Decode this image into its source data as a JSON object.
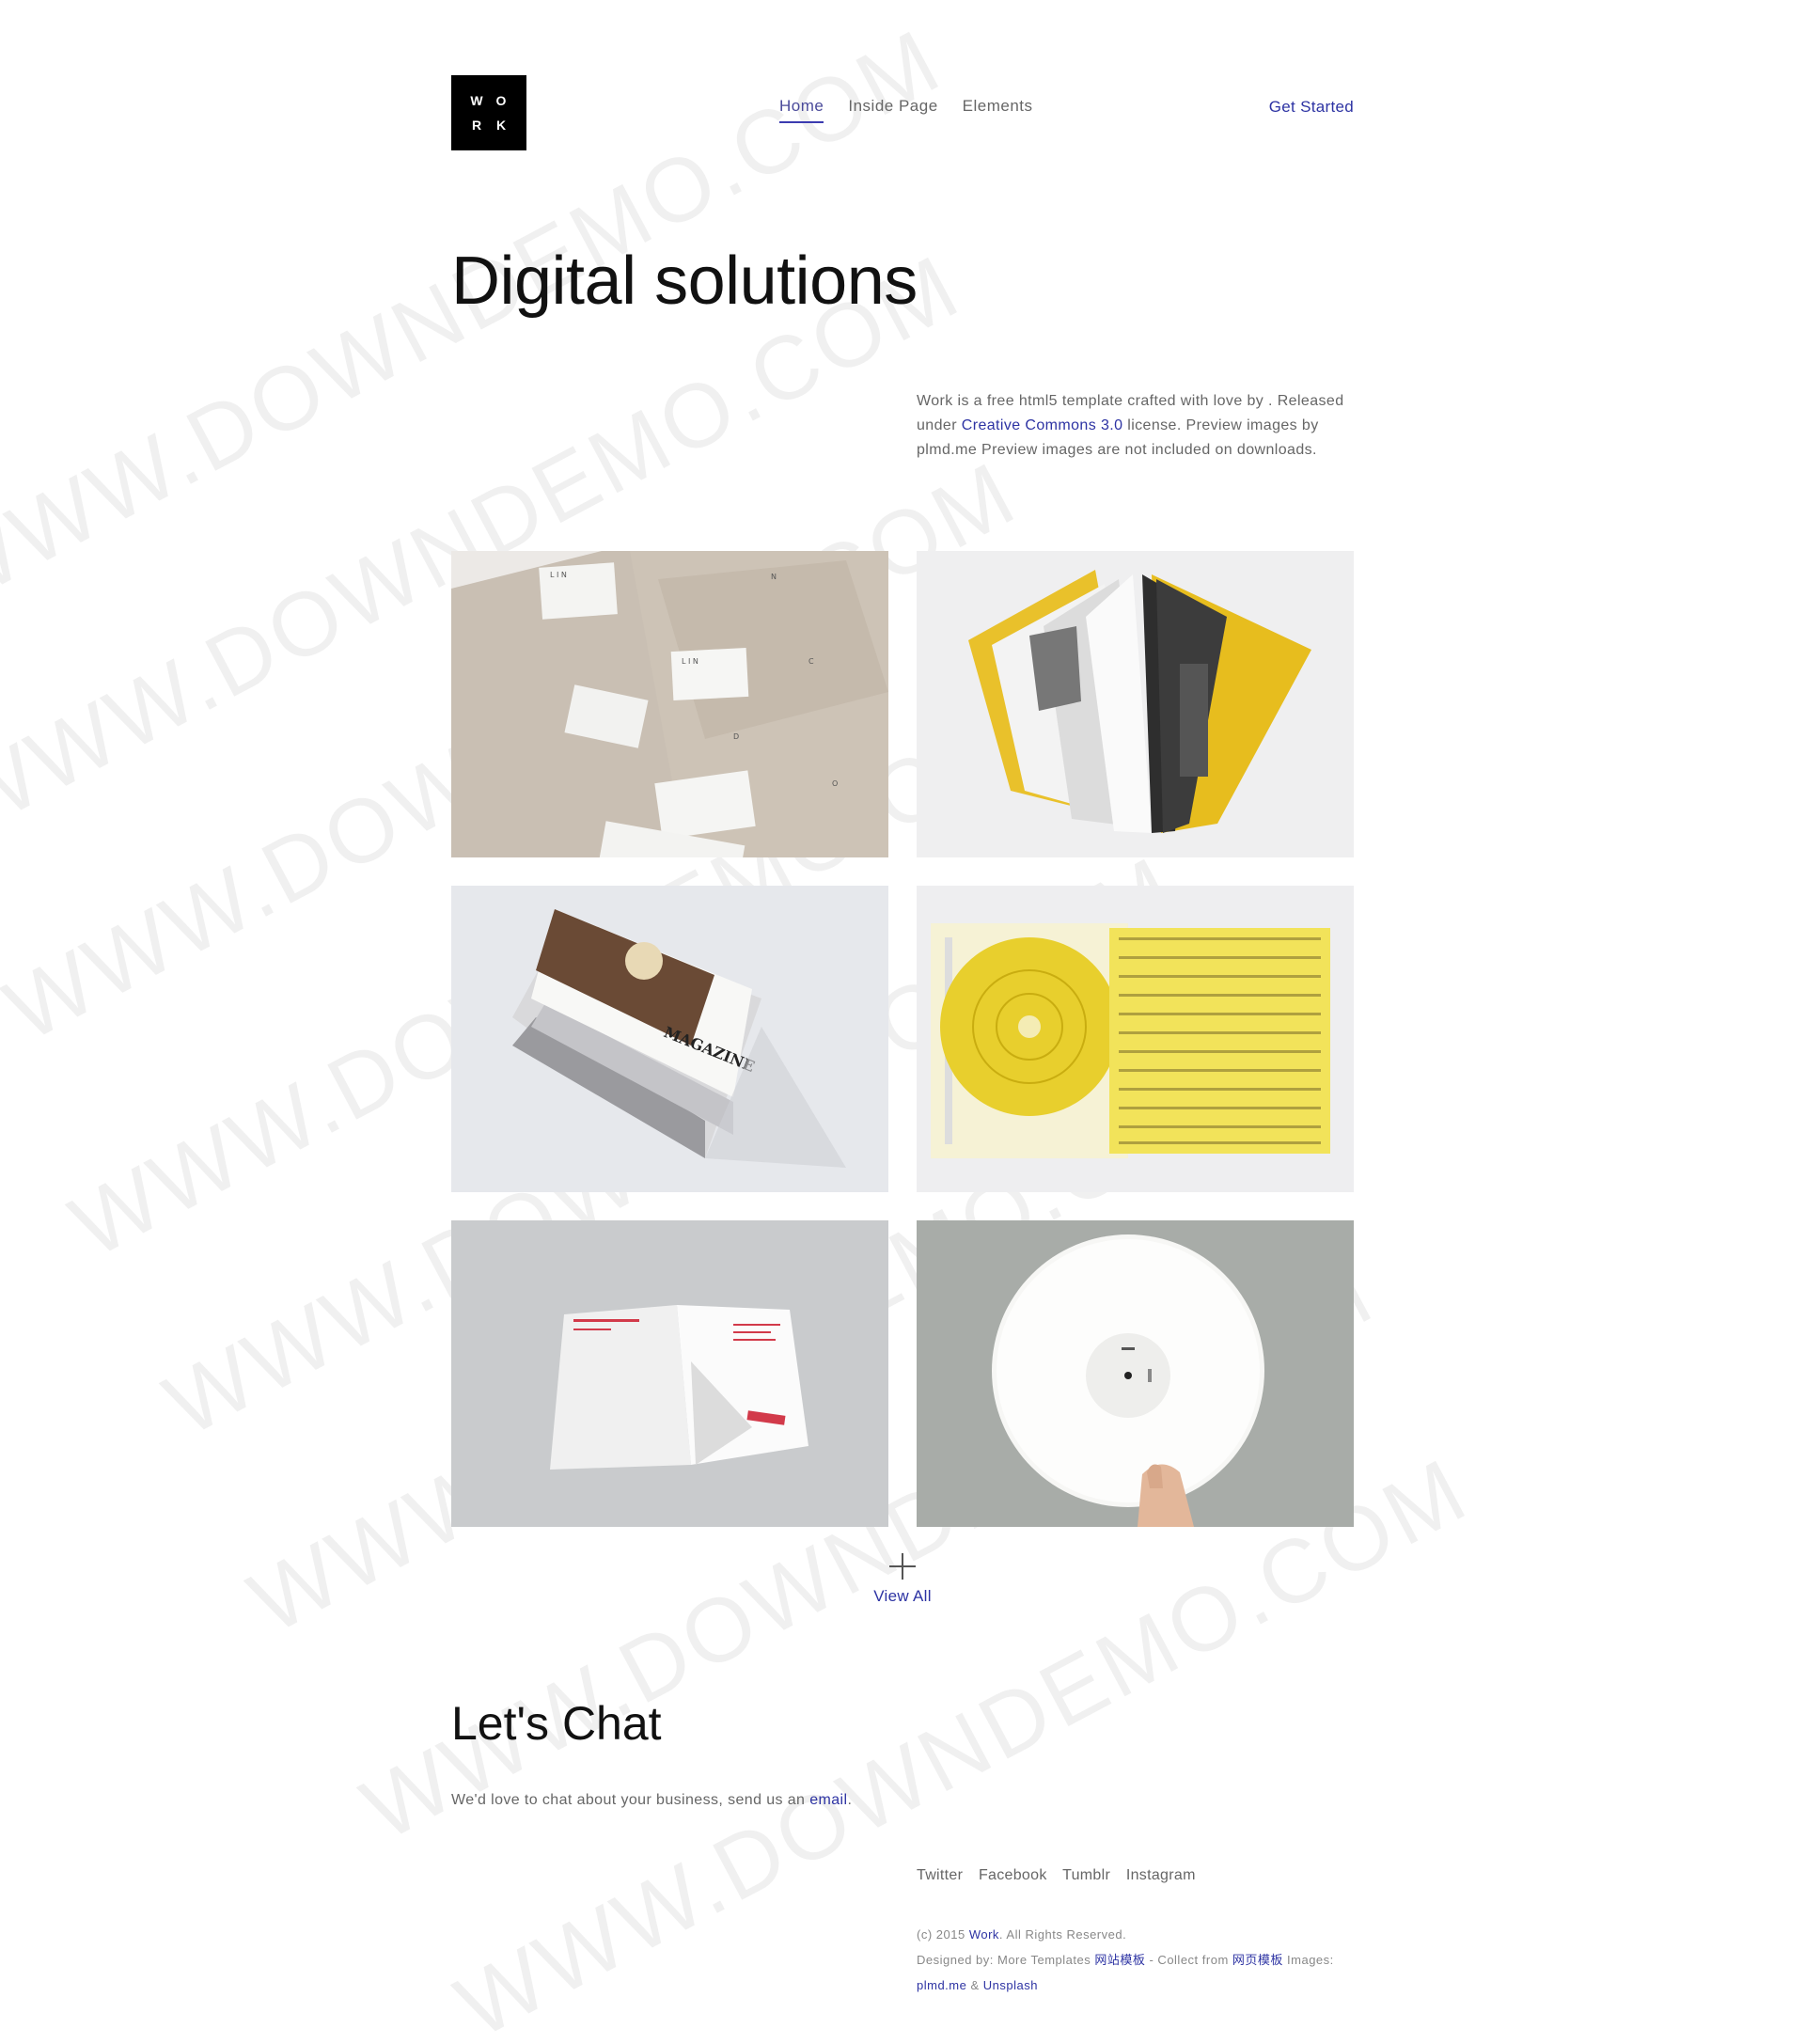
{
  "header": {
    "logo": {
      "letters": [
        "W",
        "O",
        "R",
        "K"
      ]
    },
    "nav": [
      {
        "label": "Home",
        "active": true
      },
      {
        "label": "Inside Page",
        "active": false
      },
      {
        "label": "Elements",
        "active": false
      }
    ],
    "cta": "Get Started"
  },
  "hero": {
    "title": "Digital solutions",
    "intro_part1": "Work is a free html5 template crafted with love by . Released under ",
    "intro_link": "Creative Commons 3.0",
    "intro_part2": " license. Preview images by plmd.me Preview images are not included on downloads."
  },
  "gallery": {
    "items": [
      {
        "subject": "business-cards-photo"
      },
      {
        "subject": "yellow-book-photo"
      },
      {
        "subject": "magazine-stack-photo",
        "label": "MAGAZINE"
      },
      {
        "subject": "yellow-cd-photo"
      },
      {
        "subject": "folded-letter-photo"
      },
      {
        "subject": "white-vinyl-record-photo"
      }
    ],
    "view_all": "View All"
  },
  "chat": {
    "title": "Let's Chat",
    "text_part1": "We'd love to chat about your business, send us an ",
    "link": "email",
    "text_part2": "."
  },
  "footer": {
    "social": [
      "Twitter",
      "Facebook",
      "Tumblr",
      "Instagram"
    ],
    "copyright_prefix": "(c) 2015 ",
    "copyright_link": "Work",
    "copyright_suffix": ". All Rights Reserved.",
    "designed_prefix": "Designed by: More Templates ",
    "designed_link1": "网站模板",
    "designed_mid": " - Collect from ",
    "designed_link2": "网页模板",
    "designed_images": " Images:",
    "images_link1": "plmd.me",
    "images_amp": " & ",
    "images_link2": "Unsplash"
  },
  "watermark": {
    "text": "WWW.DOWNDEMO.COM"
  },
  "colors": {
    "accent": "#2d33a3",
    "text": "#666666",
    "heading": "#111111"
  }
}
